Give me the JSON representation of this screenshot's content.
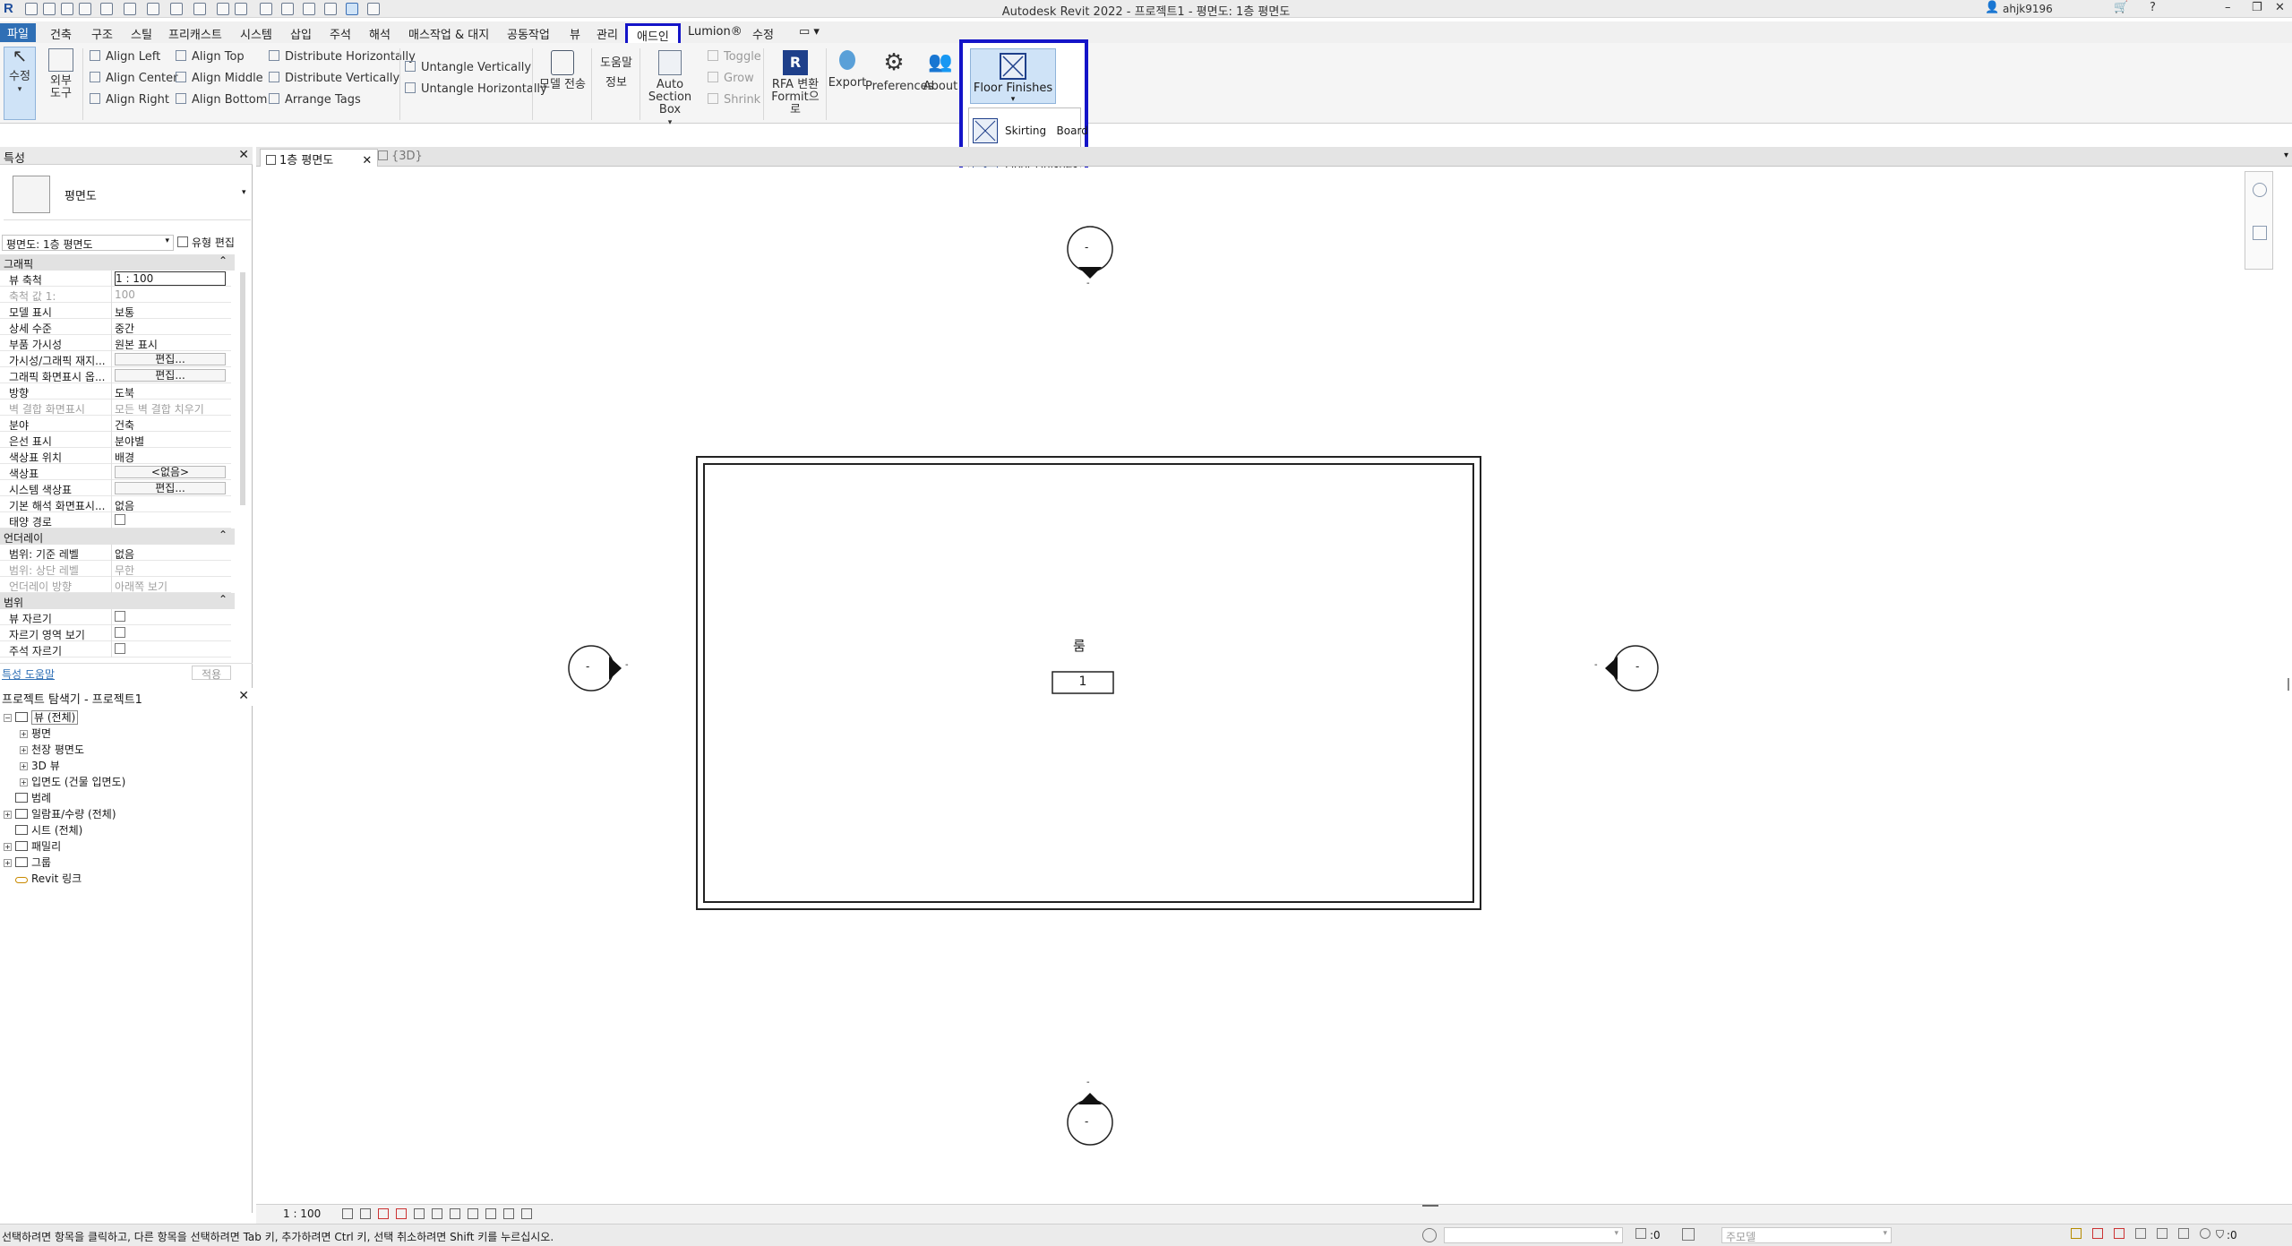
{
  "titlebar": {
    "title": "Autodesk Revit 2022 - 프로젝트1 - 평면도: 1층 평면도",
    "user": "ahjk9196",
    "help": "?",
    "min": "–",
    "restore": "❐",
    "close": "✕"
  },
  "tabs": [
    "파일",
    "건축",
    "구조",
    "스틸",
    "프리캐스트",
    "시스템",
    "삽입",
    "주석",
    "해석",
    "매스작업 & 대지",
    "공동작업",
    "뷰",
    "관리",
    "애드인",
    "Lumion®",
    "수정"
  ],
  "ribbon": {
    "modify_label": "수정",
    "external_tools_line1": "외부",
    "external_tools_line2": "도구",
    "align": [
      "Align Left",
      "Align Center",
      "Align Right",
      "Align Top",
      "Align Middle",
      "Align Bottom",
      "Distribute Horizontally",
      "Distribute Vertically",
      "Arrange Tags"
    ],
    "untangle": [
      "Untangle Vertically",
      "Untangle Horizontally"
    ],
    "model_transfer": "모델 전송",
    "help_info_line1": "도움말",
    "help_info_line2": "정보",
    "auto_section_line1": "Auto",
    "auto_section_line2": "Section Box",
    "toggle": "Toggle",
    "grow": "Grow",
    "shrink": "Shrink",
    "rfa_line1": "RFA 변환",
    "rfa_line2": "Formit으로",
    "export": "Export",
    "preferences": "Preferences",
    "about": "About",
    "floor_finishes": "Floor Finishes",
    "menu": [
      "Skirting   Board",
      "Floor Finishes"
    ]
  },
  "properties": {
    "title": "특성",
    "type_name": "평면도",
    "selector": "평면도: 1층 평면도",
    "edit_type": "유형 편집",
    "sections": {
      "graphics": "그래픽",
      "underlay": "언더레이",
      "extents": "범위"
    },
    "graphics_rows": [
      {
        "k": "뷰 축척",
        "v": "1 : 100",
        "grey": false
      },
      {
        "k": "축척 값    1:",
        "v": "100",
        "grey": true
      },
      {
        "k": "모델 표시",
        "v": "보통",
        "grey": false
      },
      {
        "k": "상세 수준",
        "v": "중간",
        "grey": false
      },
      {
        "k": "부품 가시성",
        "v": "원본 표시",
        "grey": false
      },
      {
        "k": "가시성/그래픽 재지...",
        "v": "편집...",
        "grey": false
      },
      {
        "k": "그래픽 화면표시 옵...",
        "v": "편집...",
        "grey": false
      },
      {
        "k": "방향",
        "v": "도북",
        "grey": false
      },
      {
        "k": "벽 결합 화면표시",
        "v": "모든 벽 결합 치우기",
        "grey": true
      },
      {
        "k": "분야",
        "v": "건축",
        "grey": false
      },
      {
        "k": "은선 표시",
        "v": "분야별",
        "grey": false
      },
      {
        "k": "색상표 위치",
        "v": "배경",
        "grey": false
      },
      {
        "k": "색상표",
        "v": "<없음>",
        "grey": false
      },
      {
        "k": "시스템 색상표",
        "v": "편집...",
        "grey": false
      },
      {
        "k": "기본 해석 화면표시...",
        "v": "없음",
        "grey": false
      },
      {
        "k": "태양 경로",
        "v": "",
        "grey": false
      }
    ],
    "underlay_rows": [
      {
        "k": "범위: 기준 레벨",
        "v": "없음",
        "grey": false
      },
      {
        "k": "범위: 상단 레벨",
        "v": "무한",
        "grey": true
      },
      {
        "k": "언더레이 방향",
        "v": "아래쪽 보기",
        "grey": true
      }
    ],
    "extents_rows": [
      {
        "k": "뷰 자르기",
        "v": ""
      },
      {
        "k": "자르기 영역 보기",
        "v": ""
      },
      {
        "k": "주석 자르기",
        "v": ""
      }
    ],
    "help_link": "특성 도움말",
    "apply": "적용"
  },
  "browser": {
    "title": "프로젝트 탐색기 - 프로젝트1",
    "items": [
      {
        "label": "뷰 (전체)",
        "level": 0
      },
      {
        "label": "평면",
        "level": 1
      },
      {
        "label": "천장 평면도",
        "level": 1
      },
      {
        "label": "3D 뷰",
        "level": 1
      },
      {
        "label": "입면도 (건물 입면도)",
        "level": 1
      },
      {
        "label": "범례",
        "level": 0
      },
      {
        "label": "일람표/수량 (전체)",
        "level": 0
      },
      {
        "label": "시트 (전체)",
        "level": 0
      },
      {
        "label": "패밀리",
        "level": 0
      },
      {
        "label": "그룹",
        "level": 0
      },
      {
        "label": "Revit 링크",
        "level": 0
      }
    ]
  },
  "doctabs": [
    "1층 평면도",
    "{3D}"
  ],
  "canvas": {
    "room_name": "룸",
    "room_number": "1",
    "elev_marker_label": "-"
  },
  "viewbar": {
    "scale": "1 : 100"
  },
  "statusbar": {
    "message": "선택하려면 항목을 클릭하고, 다른 항목을 선택하려면 Tab 키, 추가하려면 Ctrl 키, 선택 취소하려면 Shift 키를 누르십시오.",
    "zero": ":0",
    "model": "주모델",
    "filter_count": ":0"
  },
  "colors": {
    "accent": "#2f6fb5",
    "highlight_outline": "#1414c8",
    "ff_button_bg": "#cfe3f7"
  }
}
